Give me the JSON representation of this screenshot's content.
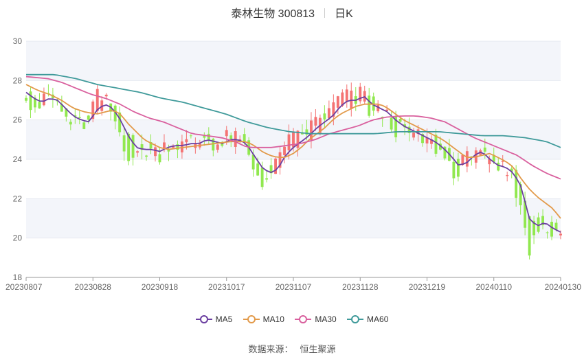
{
  "title": {
    "name": "泰林生物 300813",
    "period": "日K"
  },
  "source": {
    "label": "数据来源：",
    "value": "恒生聚源"
  },
  "colors": {
    "up": "#f47373",
    "down": "#91e84f",
    "ma5": "#6b3fa0",
    "ma10": "#e29a4a",
    "ma30": "#d9609e",
    "ma60": "#3f9a9a"
  },
  "chart_data": {
    "type": "candlestick",
    "ylim": [
      18,
      30
    ],
    "y_ticks": [
      18,
      20,
      22,
      24,
      26,
      28,
      30
    ],
    "x_tick_labels": [
      "20230807",
      "20230828",
      "20230918",
      "20231017",
      "20231107",
      "20231128",
      "20231219",
      "20240110",
      "20240130"
    ],
    "x_tick_sessions": [
      0,
      15,
      30,
      45,
      60,
      75,
      90,
      105,
      120
    ],
    "grid": true,
    "legend_position": "bottom",
    "series": [
      {
        "name": "MA5",
        "color": "#6b3fa0",
        "anchors": [
          [
            0,
            27.4
          ],
          [
            2,
            27.1
          ],
          [
            4,
            26.9
          ],
          [
            6,
            27.1
          ],
          [
            8,
            27.0
          ],
          [
            10,
            26.6
          ],
          [
            12,
            26.2
          ],
          [
            14,
            26.0
          ],
          [
            16,
            25.9
          ],
          [
            18,
            26.5
          ],
          [
            20,
            26.8
          ],
          [
            22,
            26.6
          ],
          [
            24,
            26.0
          ],
          [
            26,
            25.2
          ],
          [
            28,
            24.6
          ],
          [
            30,
            24.5
          ],
          [
            32,
            24.5
          ],
          [
            34,
            24.4
          ],
          [
            36,
            24.6
          ],
          [
            38,
            24.7
          ],
          [
            40,
            24.7
          ],
          [
            42,
            24.8
          ],
          [
            44,
            24.8
          ],
          [
            46,
            25.0
          ],
          [
            48,
            24.9
          ],
          [
            50,
            24.8
          ],
          [
            52,
            25.0
          ],
          [
            54,
            25.0
          ],
          [
            56,
            24.8
          ],
          [
            58,
            24.2
          ],
          [
            60,
            23.6
          ],
          [
            62,
            23.3
          ],
          [
            64,
            23.5
          ],
          [
            66,
            24.2
          ],
          [
            68,
            24.6
          ],
          [
            70,
            24.9
          ],
          [
            72,
            25.2
          ],
          [
            74,
            25.6
          ],
          [
            76,
            25.9
          ],
          [
            78,
            26.2
          ],
          [
            80,
            26.7
          ],
          [
            82,
            27.0
          ],
          [
            84,
            27.0
          ],
          [
            86,
            27.2
          ],
          [
            88,
            26.8
          ],
          [
            90,
            26.6
          ],
          [
            92,
            26.4
          ],
          [
            94,
            26.0
          ],
          [
            96,
            25.7
          ],
          [
            98,
            25.5
          ],
          [
            100,
            25.3
          ],
          [
            102,
            25.1
          ],
          [
            104,
            24.9
          ],
          [
            106,
            24.6
          ],
          [
            108,
            24.2
          ],
          [
            110,
            23.7
          ],
          [
            112,
            23.8
          ],
          [
            114,
            24.2
          ],
          [
            116,
            24.4
          ],
          [
            118,
            24.0
          ],
          [
            120,
            23.7
          ],
          [
            122,
            23.6
          ],
          [
            124,
            23.3
          ],
          [
            126,
            22.6
          ],
          [
            128,
            21.0
          ],
          [
            130,
            20.6
          ],
          [
            132,
            20.8
          ],
          [
            134,
            20.5
          ],
          [
            136,
            20.3
          ]
        ]
      },
      {
        "name": "MA10",
        "color": "#e29a4a",
        "anchors": [
          [
            0,
            27.8
          ],
          [
            3,
            27.5
          ],
          [
            6,
            27.3
          ],
          [
            9,
            27.0
          ],
          [
            12,
            26.6
          ],
          [
            15,
            26.4
          ],
          [
            18,
            26.3
          ],
          [
            20,
            26.4
          ],
          [
            22,
            26.5
          ],
          [
            24,
            26.3
          ],
          [
            26,
            25.8
          ],
          [
            28,
            25.4
          ],
          [
            30,
            25.0
          ],
          [
            32,
            24.8
          ],
          [
            34,
            24.6
          ],
          [
            36,
            24.5
          ],
          [
            40,
            24.6
          ],
          [
            44,
            24.7
          ],
          [
            48,
            24.8
          ],
          [
            52,
            24.9
          ],
          [
            56,
            24.9
          ],
          [
            58,
            24.7
          ],
          [
            60,
            24.4
          ],
          [
            62,
            24.2
          ],
          [
            64,
            24.1
          ],
          [
            66,
            24.1
          ],
          [
            68,
            24.3
          ],
          [
            70,
            24.6
          ],
          [
            72,
            25.0
          ],
          [
            74,
            25.3
          ],
          [
            76,
            25.6
          ],
          [
            78,
            26.0
          ],
          [
            80,
            26.3
          ],
          [
            82,
            26.5
          ],
          [
            84,
            26.7
          ],
          [
            86,
            26.8
          ],
          [
            88,
            26.8
          ],
          [
            90,
            26.8
          ],
          [
            92,
            26.6
          ],
          [
            94,
            26.3
          ],
          [
            96,
            26.0
          ],
          [
            98,
            25.8
          ],
          [
            100,
            25.6
          ],
          [
            102,
            25.4
          ],
          [
            104,
            25.2
          ],
          [
            106,
            25.0
          ],
          [
            108,
            24.7
          ],
          [
            110,
            24.4
          ],
          [
            112,
            24.1
          ],
          [
            114,
            24.1
          ],
          [
            116,
            24.2
          ],
          [
            118,
            24.3
          ],
          [
            120,
            24.1
          ],
          [
            122,
            23.9
          ],
          [
            124,
            23.6
          ],
          [
            126,
            23.0
          ],
          [
            128,
            22.5
          ],
          [
            130,
            22.1
          ],
          [
            132,
            21.8
          ],
          [
            134,
            21.5
          ],
          [
            136,
            21.0
          ]
        ]
      },
      {
        "name": "MA30",
        "color": "#d9609e",
        "anchors": [
          [
            0,
            28.2
          ],
          [
            6,
            28.1
          ],
          [
            10,
            27.9
          ],
          [
            14,
            27.6
          ],
          [
            18,
            27.3
          ],
          [
            22,
            27.1
          ],
          [
            26,
            26.8
          ],
          [
            30,
            26.4
          ],
          [
            34,
            26.1
          ],
          [
            38,
            25.9
          ],
          [
            42,
            25.6
          ],
          [
            46,
            25.3
          ],
          [
            50,
            25.2
          ],
          [
            54,
            25.1
          ],
          [
            58,
            24.9
          ],
          [
            60,
            24.7
          ],
          [
            62,
            24.6
          ],
          [
            64,
            24.6
          ],
          [
            68,
            24.6
          ],
          [
            72,
            24.7
          ],
          [
            76,
            24.8
          ],
          [
            80,
            25.0
          ],
          [
            84,
            25.3
          ],
          [
            88,
            25.5
          ],
          [
            92,
            25.7
          ],
          [
            96,
            26.0
          ],
          [
            100,
            26.15
          ],
          [
            104,
            26.2
          ],
          [
            108,
            26.2
          ],
          [
            112,
            26.1
          ],
          [
            116,
            25.9
          ],
          [
            120,
            25.5
          ],
          [
            124,
            25.1
          ],
          [
            128,
            24.8
          ],
          [
            132,
            24.5
          ],
          [
            136,
            24.2
          ],
          [
            140,
            23.7
          ],
          [
            144,
            23.3
          ],
          [
            148,
            23.0
          ]
        ]
      },
      {
        "name": "MA60",
        "color": "#3f9a9a",
        "anchors": [
          [
            0,
            28.3
          ],
          [
            8,
            28.3
          ],
          [
            14,
            28.1
          ],
          [
            20,
            27.8
          ],
          [
            26,
            27.6
          ],
          [
            32,
            27.4
          ],
          [
            38,
            27.1
          ],
          [
            44,
            26.9
          ],
          [
            50,
            26.6
          ],
          [
            56,
            26.3
          ],
          [
            62,
            25.9
          ],
          [
            68,
            25.6
          ],
          [
            74,
            25.4
          ],
          [
            80,
            25.3
          ],
          [
            86,
            25.3
          ],
          [
            92,
            25.3
          ],
          [
            98,
            25.3
          ],
          [
            104,
            25.4
          ],
          [
            110,
            25.4
          ],
          [
            116,
            25.4
          ],
          [
            122,
            25.3
          ],
          [
            128,
            25.2
          ],
          [
            134,
            25.2
          ],
          [
            140,
            25.1
          ],
          [
            146,
            24.9
          ],
          [
            150,
            24.6
          ]
        ]
      }
    ]
  }
}
